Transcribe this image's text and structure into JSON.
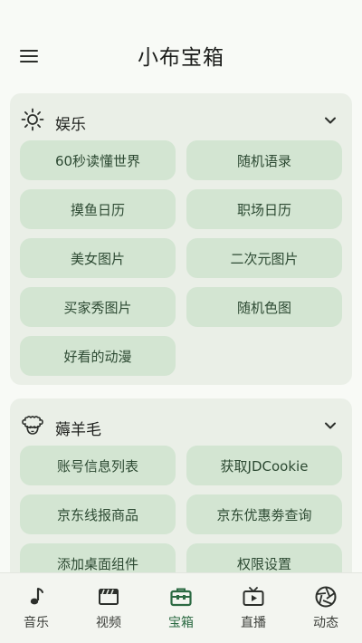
{
  "app": {
    "title": "小布宝箱"
  },
  "sections": [
    {
      "title": "娱乐",
      "icon": "sun-icon",
      "items": [
        {
          "label": "60秒读懂世界"
        },
        {
          "label": "随机语录"
        },
        {
          "label": "摸鱼日历"
        },
        {
          "label": "职场日历"
        },
        {
          "label": "美女图片"
        },
        {
          "label": "二次元图片"
        },
        {
          "label": "买家秀图片"
        },
        {
          "label": "随机色图"
        },
        {
          "label": "好看的动漫"
        }
      ]
    },
    {
      "title": "薅羊毛",
      "icon": "sheep-icon",
      "items": [
        {
          "label": "账号信息列表"
        },
        {
          "label": "获取JDCookie"
        },
        {
          "label": "京东线报商品"
        },
        {
          "label": "京东优惠劵查询"
        },
        {
          "label": "添加桌面组件"
        },
        {
          "label": "权限设置"
        }
      ]
    }
  ],
  "bottom_nav": [
    {
      "label": "音乐",
      "icon": "music-note-icon"
    },
    {
      "label": "视频",
      "icon": "clapperboard-icon"
    },
    {
      "label": "宝箱",
      "icon": "toolbox-icon",
      "active": true
    },
    {
      "label": "直播",
      "icon": "tv-icon"
    },
    {
      "label": "动态",
      "icon": "aperture-icon"
    }
  ],
  "colors": {
    "background": "#f8faf6",
    "card": "#eaefe7",
    "button": "#d3e5d2",
    "button_text": "#2d4a33",
    "active_nav": "#2c6a43"
  }
}
